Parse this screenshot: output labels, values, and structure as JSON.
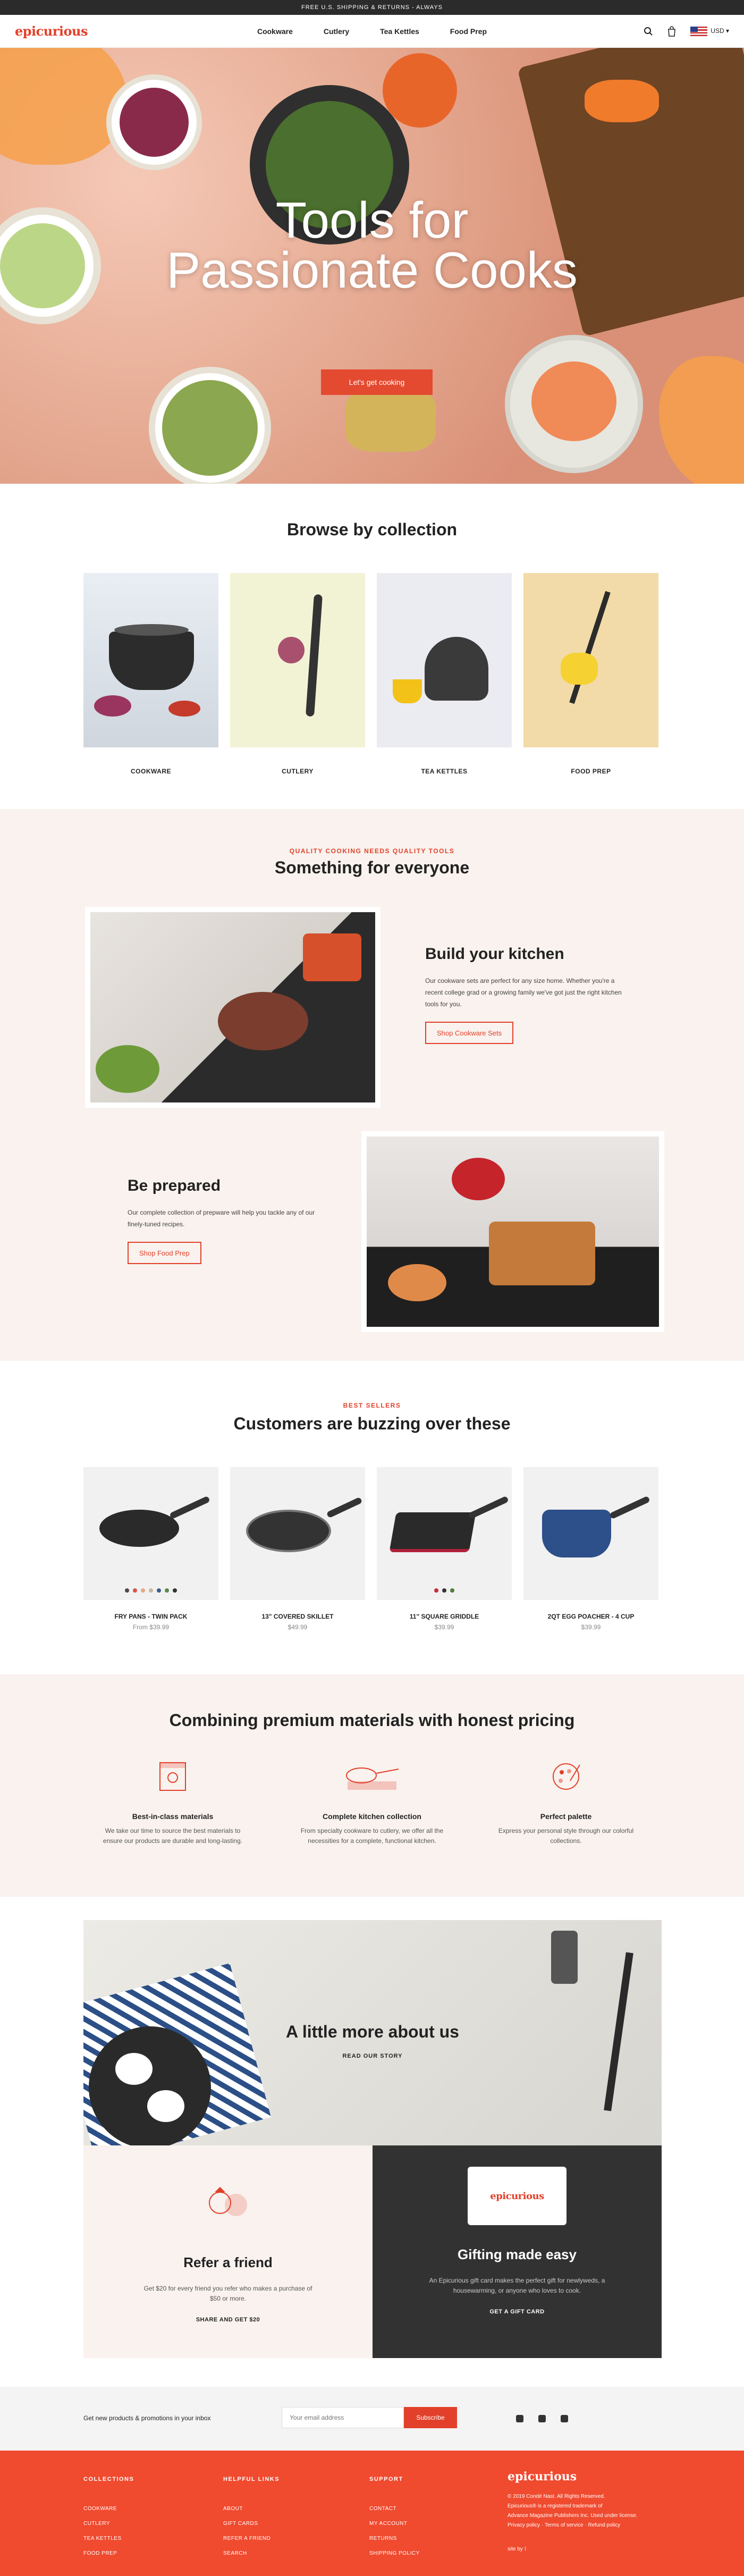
{
  "topbar": {
    "text": "FREE U.S. SHIPPING & RETURNS - ALWAYS"
  },
  "header": {
    "logo": "epicurious",
    "nav": [
      "Cookware",
      "Cutlery",
      "Tea Kettles",
      "Food Prep"
    ],
    "currency": "USD"
  },
  "hero": {
    "title_line1": "Tools for",
    "title_line2": "Passionate Cooks",
    "button": "Let's get cooking"
  },
  "collections": {
    "title": "Browse by collection",
    "items": [
      "COOKWARE",
      "CUTLERY",
      "TEA KETTLES",
      "FOOD PREP"
    ]
  },
  "everyone": {
    "eyebrow": "QUALITY COOKING NEEDS QUALITY TOOLS",
    "title": "Something for everyone",
    "kitchen": {
      "title": "Build your kitchen",
      "body": "Our cookware sets are perfect for any size home. Whether you're a recent college grad or a growing family we've got just the right kitchen tools for you.",
      "button": "Shop Cookware Sets"
    },
    "prepared": {
      "title": "Be prepared",
      "body": "Our complete collection of prepware will help you tackle any of our finely-tuned recipes.",
      "button": "Shop Food Prep"
    }
  },
  "bestsellers": {
    "eyebrow": "BEST SELLERS",
    "title": "Customers are buzzing over these",
    "products": [
      {
        "name": "FRY PANS - TWIN PACK",
        "price": "From $39.99",
        "colors": [
          "#4a4a4a",
          "#d9534f",
          "#e8a78a",
          "#c9b8a3",
          "#3e5d8c",
          "#5a8a4a",
          "#333333"
        ]
      },
      {
        "name": "13\" COVERED SKILLET",
        "price": "$49.99",
        "colors": []
      },
      {
        "name": "11\" SQUARE GRIDDLE",
        "price": "$39.99",
        "colors": [
          "#c62d3a",
          "#333333",
          "#4e7d3a"
        ]
      },
      {
        "name": "2QT EGG POACHER - 4 CUP",
        "price": "$39.99",
        "colors": []
      }
    ]
  },
  "materials": {
    "title": "Combining premium materials with honest pricing",
    "features": [
      {
        "title": "Best-in-class materials",
        "body": "We take our time to source the best materials to ensure our products are durable and long-lasting."
      },
      {
        "title": "Complete kitchen collection",
        "body": "From specialty cookware to cutlery, we offer all the necessities for a complete, functional kitchen."
      },
      {
        "title": "Perfect palette",
        "body": "Express your personal style through our colorful collections."
      }
    ]
  },
  "about": {
    "title": "A little more about us",
    "link": "READ OUR STORY"
  },
  "refer": {
    "title": "Refer a friend",
    "body": "Get $20 for every friend you refer who makes a purchase of $50 or more.",
    "link": "SHARE AND GET $20"
  },
  "gift": {
    "card_logo": "epicurious",
    "title": "Gifting made easy",
    "body": "An Epicurious gift card makes the perfect gift for newlyweds, a housewarming, or anyone who loves to cook.",
    "link": "GET A GIFT CARD"
  },
  "newsletter": {
    "text": "Get new products & promotions in your inbox",
    "placeholder": "Your email address",
    "button": "Subscribe"
  },
  "footer": {
    "collections": {
      "title": "COLLECTIONS",
      "links": [
        "COOKWARE",
        "CUTLERY",
        "TEA KETTLES",
        "FOOD PREP"
      ]
    },
    "helpful": {
      "title": "HELPFUL LINKS",
      "links": [
        "ABOUT",
        "GIFT CARDS",
        "REFER A FRIEND",
        "SEARCH"
      ]
    },
    "support": {
      "title": "SUPPORT",
      "links": [
        "CONTACT",
        "MY ACCOUNT",
        "RETURNS",
        "SHIPPING POLICY"
      ]
    },
    "logo": "epicurious",
    "legal1": "© 2019 Condé Nast. All Rights Reserved.",
    "legal2": "Epicurious® is a registered trademark of",
    "legal3": "Advance Magazine Publishers Inc. Used under license.",
    "legal4": "Privacy policy  ·  Terms of service  ·  Refund policy",
    "site_by": "site by"
  },
  "colors": {
    "brand": "#e2402a",
    "footer": "#f04a2f",
    "dark": "#2b2b2b"
  }
}
